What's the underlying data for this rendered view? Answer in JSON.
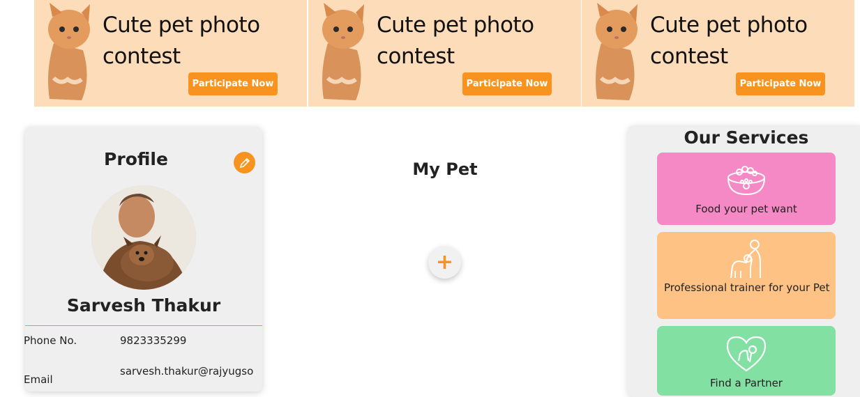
{
  "banners": [
    {
      "title": "Cute pet photo contest",
      "button": "Participate Now"
    },
    {
      "title": "Cute pet photo contest",
      "button": "Participate Now"
    },
    {
      "title": "Cute pet photo contest",
      "button": "Participate Now"
    }
  ],
  "profile": {
    "title": "Profile",
    "name": "Sarvesh Thakur",
    "phone_label": "Phone No.",
    "phone_value": "9823335299",
    "email_label": "Email",
    "email_value": "sarvesh.thakur@rajyugso"
  },
  "mypet": {
    "title": "My Pet",
    "add_symbol": "+"
  },
  "services": {
    "title": "Our Services",
    "items": [
      {
        "label": "Food your pet want",
        "color": "#f589c6",
        "icon": "pet-food-bowl-icon"
      },
      {
        "label": "Professional trainer for your Pet",
        "color": "#fec384",
        "icon": "trainer-with-dog-icon"
      },
      {
        "label": "Find a Partner",
        "color": "#82e0a2",
        "icon": "heart-pets-icon"
      }
    ]
  },
  "colors": {
    "accent": "#f7931e",
    "banner_bg": "#fddcb9",
    "card_bg": "#efefef"
  }
}
